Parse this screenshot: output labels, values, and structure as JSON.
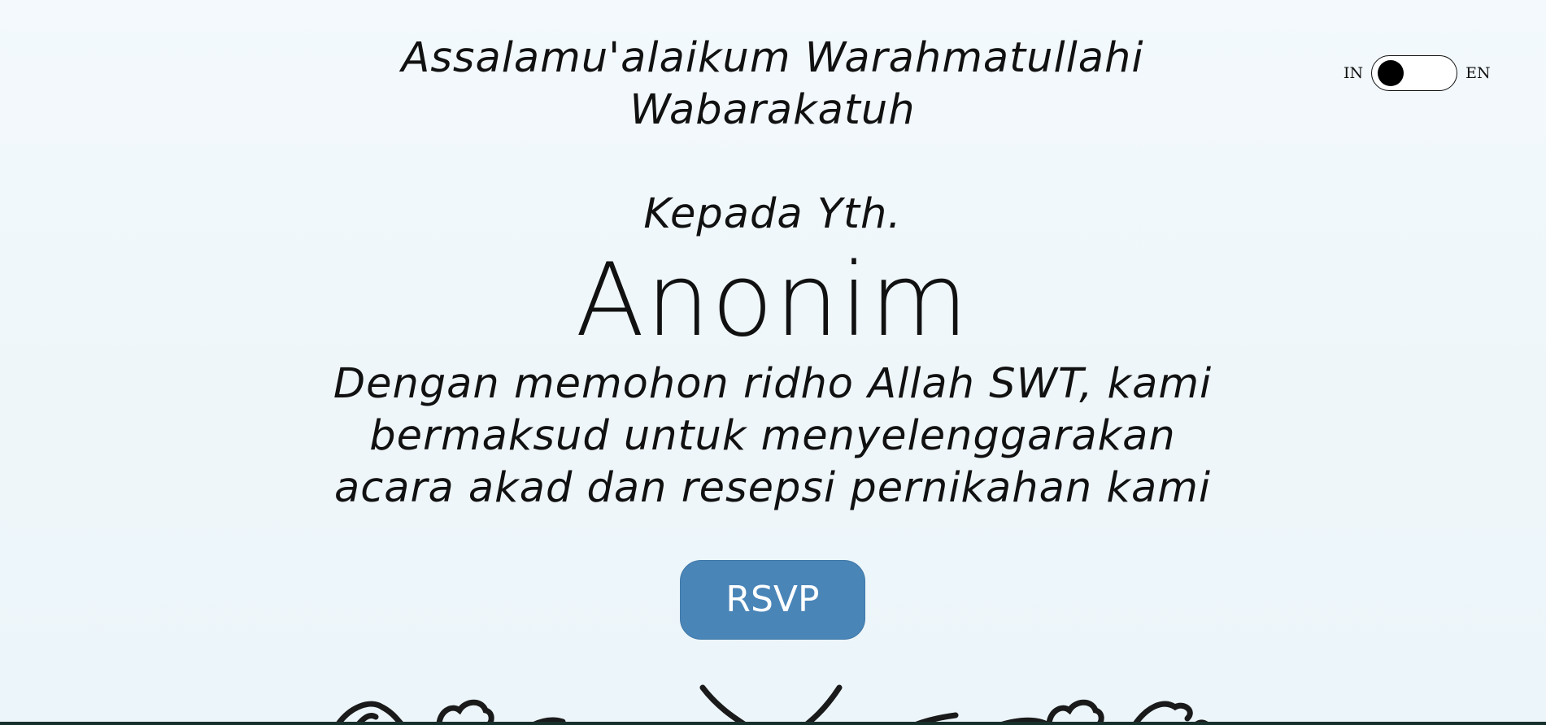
{
  "greeting": {
    "line1": "Assalamu'alaikum Warahmatullahi",
    "line2": "Wabarakatuh"
  },
  "recipient": {
    "label": "Kepada Yth.",
    "name": "Anonim"
  },
  "intro": {
    "line1": "Dengan memohon ridho Allah SWT, kami",
    "line2": "bermaksud untuk menyelenggarakan",
    "line3": "acara akad dan resepsi pernikahan kami"
  },
  "rsvp": {
    "label": "RSVP"
  },
  "language_toggle": {
    "left_label": "IN",
    "right_label": "EN",
    "selected": "IN"
  },
  "colors": {
    "button_background": "#4a85b8",
    "button_text": "#ffffff",
    "text": "#111111",
    "page_background": "#f3f9fc",
    "ornament": "#1a1a1a"
  },
  "icons": {
    "ornament": "floral-ornament-icon"
  }
}
